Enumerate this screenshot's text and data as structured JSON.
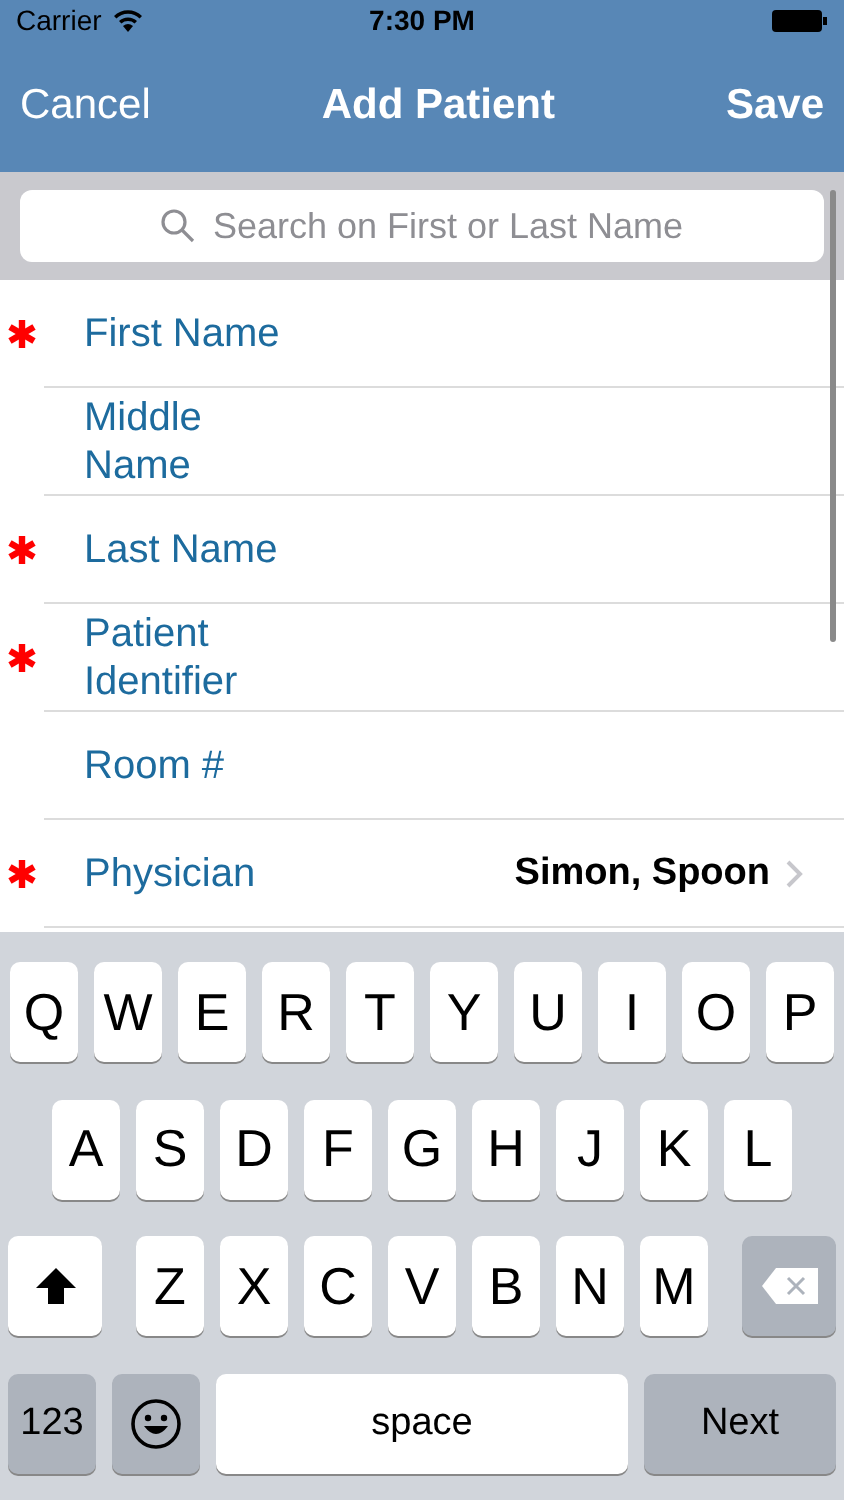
{
  "status_bar": {
    "carrier": "Carrier",
    "time": "7:30 PM"
  },
  "nav": {
    "left": "Cancel",
    "title": "Add Patient",
    "right": "Save"
  },
  "search": {
    "placeholder": "Search on First or Last Name"
  },
  "fields": [
    {
      "label": "First Name",
      "required": true,
      "kind": "text"
    },
    {
      "label": "Middle Name",
      "required": false,
      "kind": "text"
    },
    {
      "label": "Last Name",
      "required": true,
      "kind": "text"
    },
    {
      "label": "Patient Identifier",
      "required": true,
      "kind": "text"
    },
    {
      "label": "Room #",
      "required": false,
      "kind": "text"
    },
    {
      "label": "Physician",
      "required": true,
      "kind": "picker",
      "value": "Simon, Spoon"
    }
  ],
  "keyboard": {
    "rows": [
      [
        "Q",
        "W",
        "E",
        "R",
        "T",
        "Y",
        "U",
        "I",
        "O",
        "P"
      ],
      [
        "A",
        "S",
        "D",
        "F",
        "G",
        "H",
        "J",
        "K",
        "L"
      ],
      [
        "Z",
        "X",
        "C",
        "V",
        "B",
        "N",
        "M"
      ]
    ],
    "numbers_key": "123",
    "space_key": "space",
    "return_key": "Next"
  }
}
